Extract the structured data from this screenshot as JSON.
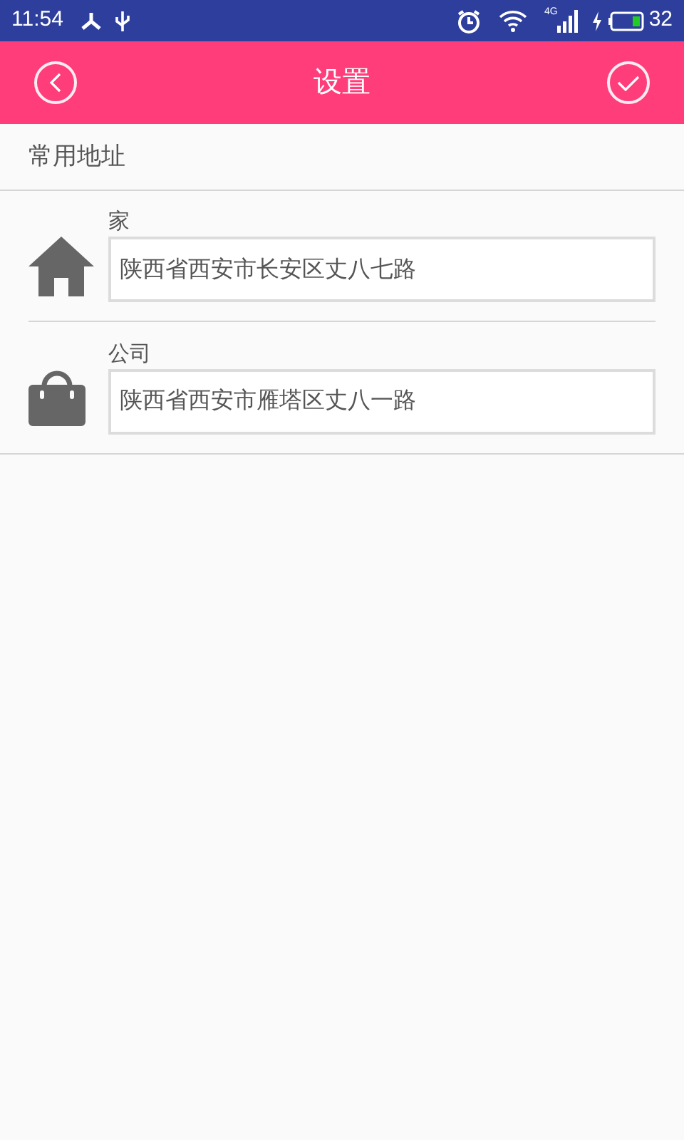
{
  "status_bar": {
    "time": "11:54",
    "network": "4G",
    "battery": "32"
  },
  "header": {
    "title": "设置"
  },
  "section": {
    "title": "常用地址"
  },
  "addresses": [
    {
      "kind": "home",
      "label": "家",
      "value": "陕西省西安市长安区丈八七路"
    },
    {
      "kind": "work",
      "label": "公司",
      "value": "陕西省西安市雁塔区丈八一路"
    }
  ]
}
